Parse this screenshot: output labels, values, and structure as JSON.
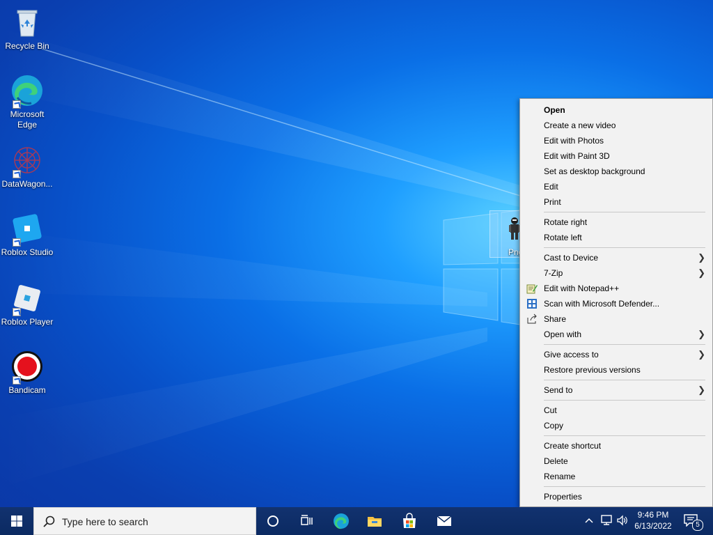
{
  "desktop": {
    "icons": [
      {
        "label": "Recycle Bin",
        "icon": "recycle-bin-icon"
      },
      {
        "label": "Microsoft Edge",
        "icon": "edge-icon"
      },
      {
        "label": "DataWagon...",
        "icon": "datawagon-icon"
      },
      {
        "label": "Roblox Studio",
        "icon": "roblox-studio-icon"
      },
      {
        "label": "Roblox Player",
        "icon": "roblox-player-icon"
      },
      {
        "label": "Bandicam",
        "icon": "bandicam-icon"
      }
    ],
    "selected_file": {
      "label": "Png"
    }
  },
  "context_menu": {
    "groups": [
      [
        {
          "label": "Open",
          "bold": true
        },
        {
          "label": "Create a new video"
        },
        {
          "label": "Edit with Photos"
        },
        {
          "label": "Edit with Paint 3D"
        },
        {
          "label": "Set as desktop background"
        },
        {
          "label": "Edit"
        },
        {
          "label": "Print"
        }
      ],
      [
        {
          "label": "Rotate right"
        },
        {
          "label": "Rotate left"
        }
      ],
      [
        {
          "label": "Cast to Device",
          "submenu": true
        },
        {
          "label": "7-Zip",
          "submenu": true
        },
        {
          "label": "Edit with Notepad++",
          "icon": "notepad-plus-icon"
        },
        {
          "label": "Scan with Microsoft Defender...",
          "icon": "defender-icon"
        },
        {
          "label": "Share",
          "icon": "share-icon"
        },
        {
          "label": "Open with",
          "submenu": true
        }
      ],
      [
        {
          "label": "Give access to",
          "submenu": true
        },
        {
          "label": "Restore previous versions"
        }
      ],
      [
        {
          "label": "Send to",
          "submenu": true
        }
      ],
      [
        {
          "label": "Cut"
        },
        {
          "label": "Copy"
        }
      ],
      [
        {
          "label": "Create shortcut"
        },
        {
          "label": "Delete"
        },
        {
          "label": "Rename"
        }
      ],
      [
        {
          "label": "Properties"
        }
      ]
    ]
  },
  "taskbar": {
    "search_placeholder": "Type here to search",
    "time": "9:46 PM",
    "date": "6/13/2022",
    "notification_count": "5",
    "accent": "#0078d7"
  }
}
